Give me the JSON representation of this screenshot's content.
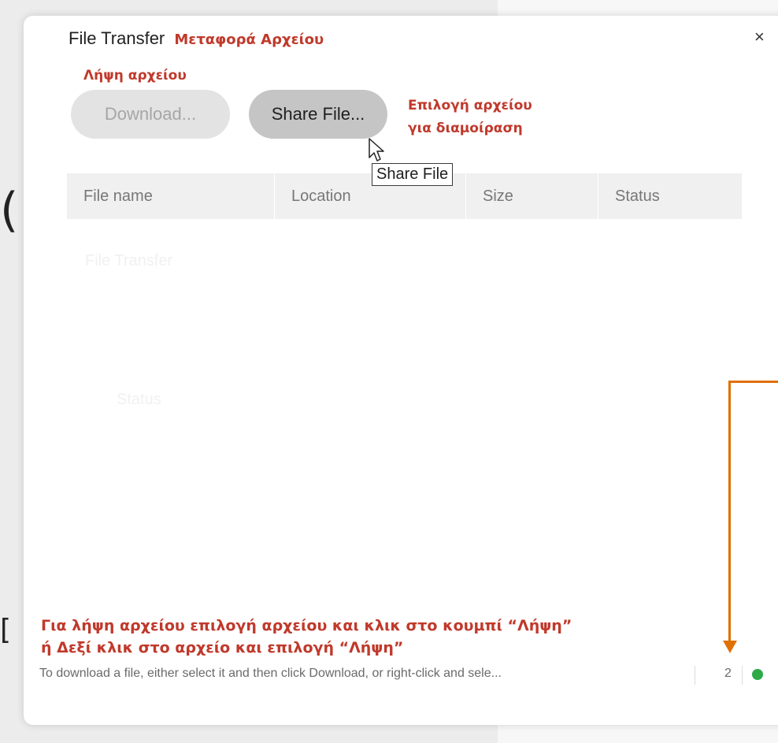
{
  "background": {
    "text_top": "(",
    "text_bottom": "["
  },
  "dialog": {
    "title": "File Transfer",
    "title_annotation": "Μεταφορά Αρχείου",
    "close_glyph": "×",
    "download_annotation": "Λήψη αρχείου",
    "download_label": "Download...",
    "share_label": "Share File...",
    "share_annotation_line1": "Επιλογή αρχείου",
    "share_annotation_line2": "για διαμοίραση",
    "tooltip": "Share File",
    "columns": [
      "File name",
      "Location",
      "Size",
      "Status"
    ],
    "ghost_text_1": "File Transfer",
    "ghost_text_2": "Status",
    "bottom_annotation_line1": "Για λήψη αρχείου επιλογή αρχείου και κλικ στο κουμπί “Λήψη”",
    "bottom_annotation_line2": "ή Δεξί κλικ στο αρχείο και επιλογή “Λήψη”",
    "status_text": "To download a file, either select it and then click Download, or right-click and sele...",
    "count": "2"
  },
  "colors": {
    "annotation": "#c0392b",
    "arrow": "#e07000",
    "status_dot": "#2eaa49"
  },
  "icons": [
    "close-icon",
    "mouse-cursor-icon",
    "connection-status-icon",
    "arrow-annotation"
  ]
}
